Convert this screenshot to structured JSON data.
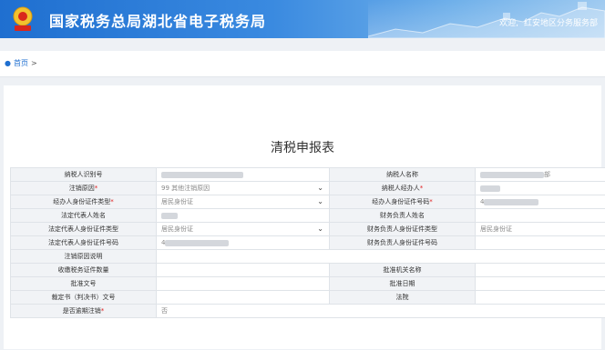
{
  "header": {
    "site_title": "国家税务总局湖北省电子税务局",
    "welcome": "欢迎,",
    "user_name": "红安地区分务服务部"
  },
  "breadcrumb": {
    "home": "首页",
    "separator": ">"
  },
  "form": {
    "title": "清税申报表",
    "rows": [
      {
        "l1": "纳税人识别号",
        "l1_req": "",
        "v1": "",
        "l2": "纳税人名称",
        "l2_req": "",
        "v2": "部"
      },
      {
        "l1": "注销原因",
        "l1_req": "*",
        "v1": "99 其他注销原因",
        "l2": "纳税人经办人",
        "l2_req": "*",
        "v2": ""
      },
      {
        "l1": "经办人身份证件类型",
        "l1_req": "*",
        "v1": "居民身份证",
        "l2": "经办人身份证件号码",
        "l2_req": "*",
        "v2": "4"
      },
      {
        "l1": "法定代表人姓名",
        "l1_req": "",
        "v1": "",
        "l2": "财务负责人姓名",
        "l2_req": "",
        "v2": ""
      },
      {
        "l1": "法定代表人身份证件类型",
        "l1_req": "",
        "v1": "居民身份证",
        "l2": "财务负责人身份证件类型",
        "l2_req": "",
        "v2": "居民身份证"
      },
      {
        "l1": "法定代表人身份证件号码",
        "l1_req": "",
        "v1": "4",
        "l2": "财务负责人身份证件号码",
        "l2_req": "",
        "v2": ""
      },
      {
        "l1": "注销原因说明",
        "l1_req": "",
        "v1": ""
      },
      {
        "l1": "收缴税务证件数量",
        "l1_req": "",
        "v1": "",
        "l2": "批准机关名称",
        "l2_req": "",
        "v2": ""
      },
      {
        "l1": "批准文号",
        "l1_req": "",
        "v1": "",
        "l2": "批准日期",
        "l2_req": "",
        "v2": ""
      },
      {
        "l1": "裁定书（判决书）文号",
        "l1_req": "",
        "v1": "",
        "l2": "法院",
        "l2_req": "",
        "v2": ""
      },
      {
        "l1": "是否逾期注销",
        "l1_req": "*",
        "v1": "否"
      }
    ]
  }
}
